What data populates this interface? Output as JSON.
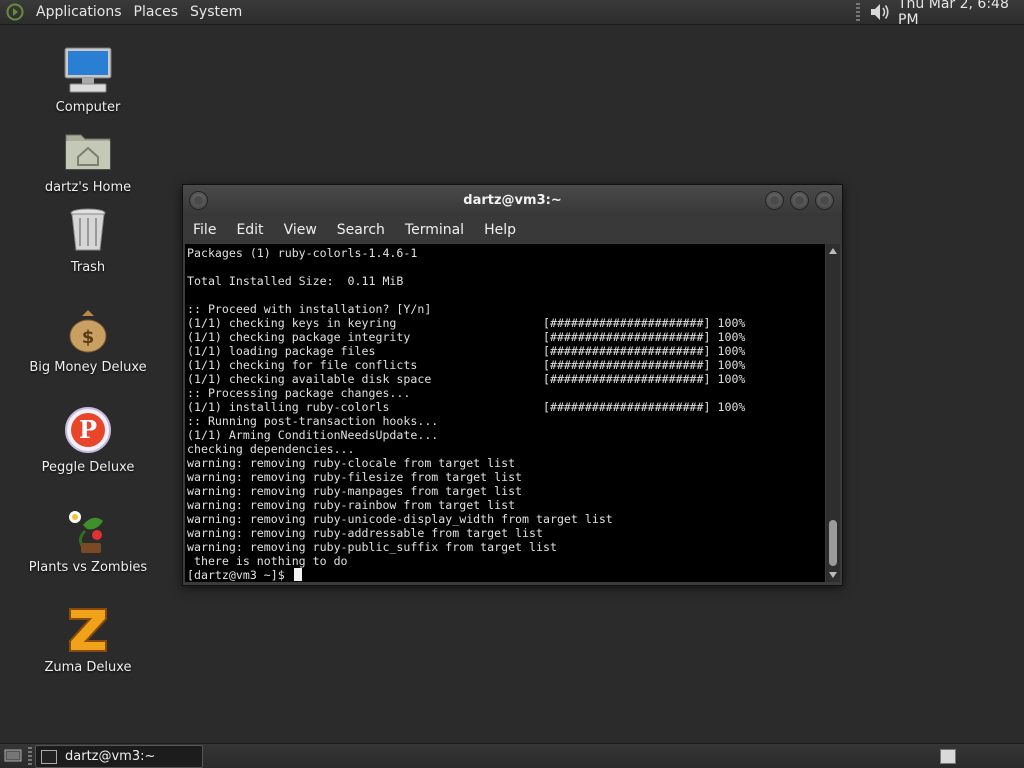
{
  "top_panel": {
    "menus": [
      "Applications",
      "Places",
      "System"
    ],
    "clock": "Thu Mar  2,  6:48 PM"
  },
  "desktop_icons": [
    {
      "label": "Computer",
      "icon": "computer-icon"
    },
    {
      "label": "dartz's Home",
      "icon": "home-folder-icon"
    },
    {
      "label": "Trash",
      "icon": "trash-icon"
    },
    {
      "label": "Big Money Deluxe",
      "icon": "money-bag-icon"
    },
    {
      "label": "Peggle Deluxe",
      "icon": "peggle-icon"
    },
    {
      "label": "Plants vs Zombies",
      "icon": "plants-icon"
    },
    {
      "label": "Zuma Deluxe",
      "icon": "zuma-icon"
    }
  ],
  "terminal": {
    "title": "dartz@vm3:~",
    "menus": [
      "File",
      "Edit",
      "View",
      "Search",
      "Terminal",
      "Help"
    ],
    "lines": [
      "Packages (1) ruby-colorls-1.4.6-1",
      "",
      "Total Installed Size:  0.11 MiB",
      "",
      ":: Proceed with installation? [Y/n]",
      "(1/1) checking keys in keyring                     [######################] 100%",
      "(1/1) checking package integrity                   [######################] 100%",
      "(1/1) loading package files                        [######################] 100%",
      "(1/1) checking for file conflicts                  [######################] 100%",
      "(1/1) checking available disk space                [######################] 100%",
      ":: Processing package changes...",
      "(1/1) installing ruby-colorls                      [######################] 100%",
      ":: Running post-transaction hooks...",
      "(1/1) Arming ConditionNeedsUpdate...",
      "checking dependencies...",
      "warning: removing ruby-clocale from target list",
      "warning: removing ruby-filesize from target list",
      "warning: removing ruby-manpages from target list",
      "warning: removing ruby-rainbow from target list",
      "warning: removing ruby-unicode-display_width from target list",
      "warning: removing ruby-addressable from target list",
      "warning: removing ruby-public_suffix from target list",
      " there is nothing to do"
    ],
    "prompt": "[dartz@vm3 ~]$ "
  },
  "bottom_panel": {
    "task_label": "dartz@vm3:~"
  }
}
